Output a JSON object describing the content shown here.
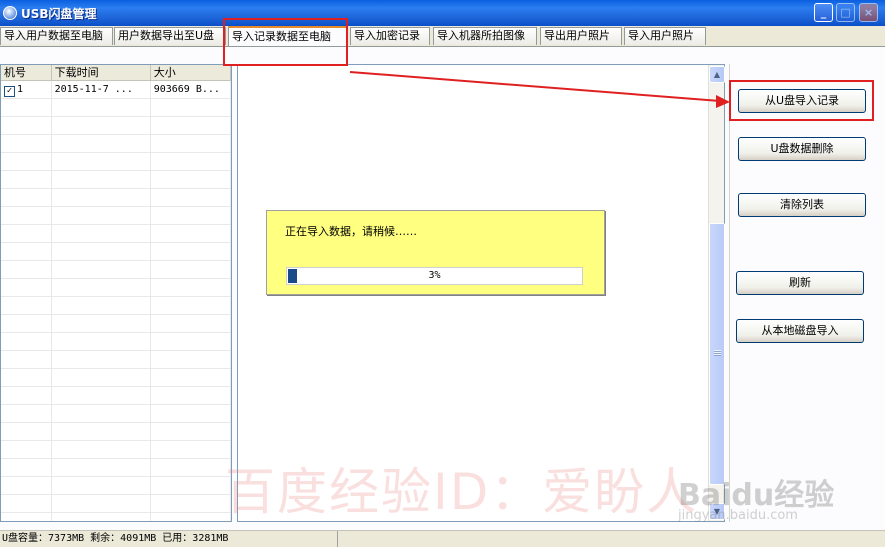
{
  "window": {
    "title": "USB闪盘管理",
    "minimize": "_",
    "maximize": "□",
    "close": "×"
  },
  "tabs": [
    {
      "label": "导入用户数据至电脑"
    },
    {
      "label": "用户数据导出至U盘"
    },
    {
      "label": "导入记录数据至电脑",
      "active": true
    },
    {
      "label": "导入加密记录"
    },
    {
      "label": "导入机器所拍图像"
    },
    {
      "label": "导出用户照片"
    },
    {
      "label": "导入用户照片"
    }
  ],
  "list": {
    "columns": [
      "机号",
      "下载时间",
      "大小"
    ],
    "rows": [
      {
        "machine": "1",
        "checked": true,
        "time": "2015-11-7 ...",
        "size": "903669 B..."
      }
    ]
  },
  "progress": {
    "message": "正在导入数据，请稍候……",
    "percent_label": "3%",
    "fraction": 0.03
  },
  "buttons": {
    "import_from_u": "从U盘导入记录",
    "delete_u_data": "U盘数据删除",
    "clear_list": "清除列表",
    "refresh": "刷新",
    "import_local": "从本地磁盘导入"
  },
  "status": {
    "text": "U盘容量：7373MB  剩余：4091MB  已用：3281MB"
  },
  "watermark": {
    "text": "百度经验ID：爱盼人",
    "logo": "Baidu经验",
    "url": "jingyan.baidu.com"
  },
  "colors": {
    "accent": "#e02020",
    "progress_fill": "#1a4a8a",
    "panel_bg": "#ffff80"
  }
}
